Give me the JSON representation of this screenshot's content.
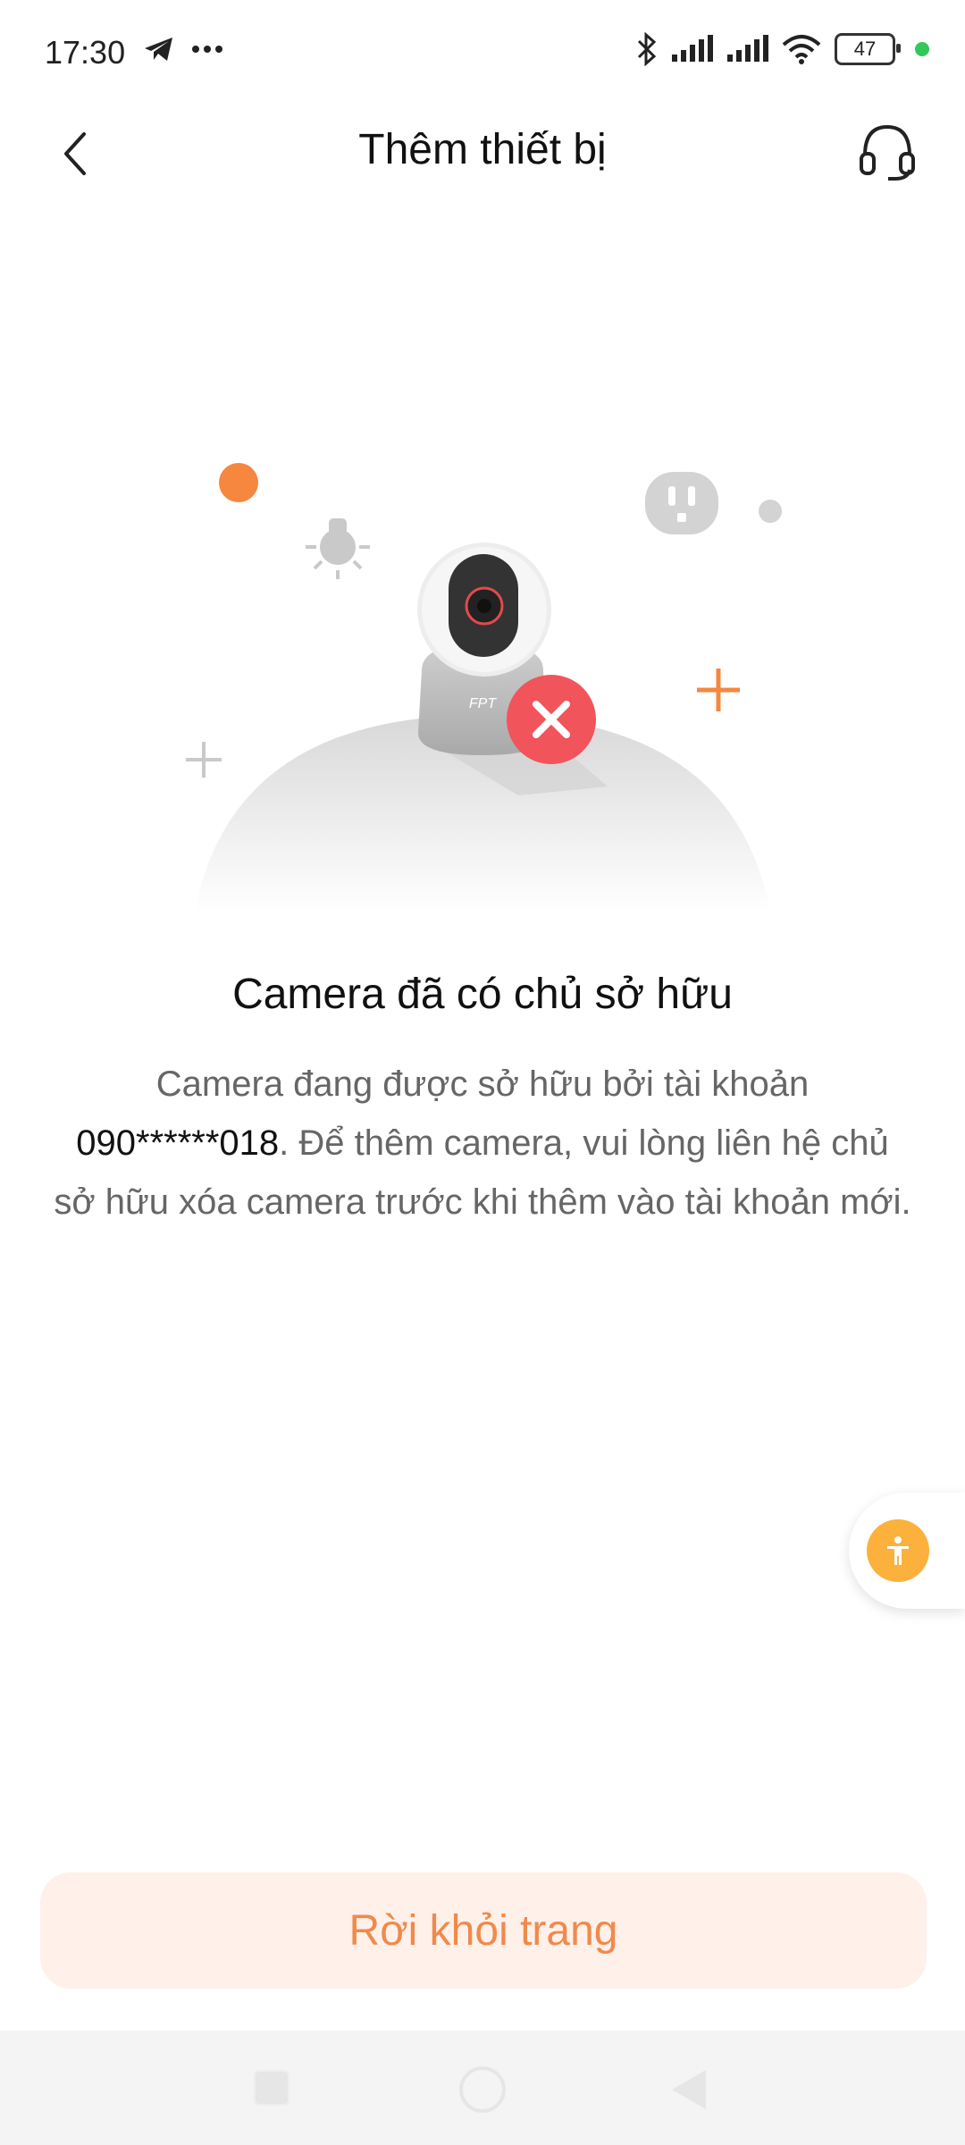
{
  "status_bar": {
    "time": "17:30",
    "battery": "47",
    "icons": [
      "telegram-icon",
      "more-icon",
      "bluetooth-icon",
      "signal-icon",
      "signal-icon",
      "wifi-icon",
      "battery-icon"
    ]
  },
  "header": {
    "title": "Thêm thiết bị",
    "back_icon": "chevron-left-icon",
    "support_icon": "headset-icon"
  },
  "illustration": {
    "brand": "FPT",
    "status_icon": "error-x-icon"
  },
  "content": {
    "title": "Camera đã có chủ sở hữu",
    "message_before": "Camera đang được sở hữu bởi tài khoản ",
    "account": "090******018",
    "message_after": ". Để thêm camera, vui lòng liên hệ chủ sở hữu xóa camera trước khi thêm vào tài khoản mới."
  },
  "buttons": {
    "leave": "Rời khỏi trang"
  },
  "colors": {
    "accent": "#f08a4b",
    "button_bg": "#fff0ea",
    "error": "#f2545b",
    "float_button": "#fbb13c"
  }
}
